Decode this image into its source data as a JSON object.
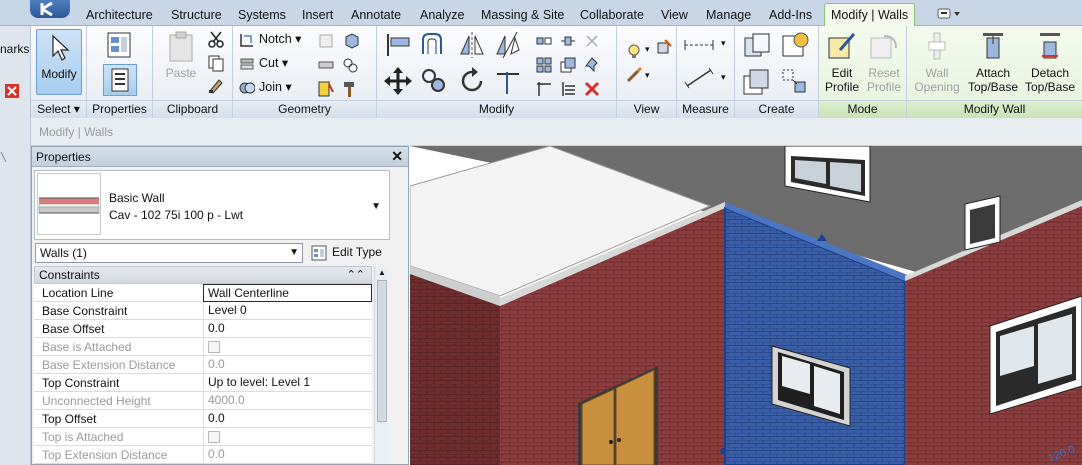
{
  "tabs": [
    {
      "label": "Architecture"
    },
    {
      "label": "Structure"
    },
    {
      "label": "Systems"
    },
    {
      "label": "Insert"
    },
    {
      "label": "Annotate"
    },
    {
      "label": "Analyze"
    },
    {
      "label": "Massing & Site"
    },
    {
      "label": "Collaborate"
    },
    {
      "label": "View"
    },
    {
      "label": "Manage"
    },
    {
      "label": "Add-Ins"
    },
    {
      "label": "Modify | Walls"
    }
  ],
  "left_strip": {
    "partial_label": "narks"
  },
  "ribbon": {
    "select": {
      "label": "Select",
      "modify_label": "Modify"
    },
    "properties": {
      "label": "Properties"
    },
    "clipboard": {
      "label": "Clipboard",
      "paste_label": "Paste"
    },
    "geometry": {
      "label": "Geometry",
      "notch_label": "Notch",
      "cut_label": "Cut",
      "join_label": "Join"
    },
    "modify": {
      "label": "Modify"
    },
    "view": {
      "label": "View"
    },
    "measure": {
      "label": "Measure"
    },
    "create": {
      "label": "Create"
    },
    "mode": {
      "label": "Mode",
      "edit_profile_label": "Edit Profile",
      "reset_profile_label": "Reset Profile"
    },
    "modify_wall": {
      "label": "Modify Wall",
      "wall_opening_label": "Wall Opening",
      "attach_label": "Attach Top/Base",
      "detach_label": "Detach Top/Base"
    }
  },
  "context_bar": {
    "text": "Modify | Walls"
  },
  "properties": {
    "title": "Properties",
    "type_family": "Basic Wall",
    "type_name": "Cav - 102 75i 100 p - Lwt",
    "instance_filter": "Walls (1)",
    "edit_type_label": "Edit Type",
    "group_name": "Constraints",
    "rows": [
      {
        "name": "Location Line",
        "value": "Wall Centerline",
        "enabled": true
      },
      {
        "name": "Base Constraint",
        "value": "Level 0",
        "enabled": true
      },
      {
        "name": "Base Offset",
        "value": "0.0",
        "enabled": true
      },
      {
        "name": "Base is Attached",
        "value": "",
        "enabled": false
      },
      {
        "name": "Base Extension Distance",
        "value": "0.0",
        "enabled": false
      },
      {
        "name": "Top Constraint",
        "value": "Up to level: Level 1",
        "enabled": true
      },
      {
        "name": "Unconnected Height",
        "value": "4000.0",
        "enabled": false
      },
      {
        "name": "Top Offset",
        "value": "0.0",
        "enabled": true
      },
      {
        "name": "Top is Attached",
        "value": "",
        "enabled": false
      },
      {
        "name": "Top Extension Distance",
        "value": "0.0",
        "enabled": false
      }
    ]
  },
  "colors": {
    "ribbon_bg": "#e6ecf3",
    "context_tab_green": "#8ec06b",
    "brick": "#8e3d3d",
    "selection_blue": "#3a5ea8",
    "door": "#c8903e"
  },
  "viewport": {
    "dimension_text": "120.0"
  }
}
